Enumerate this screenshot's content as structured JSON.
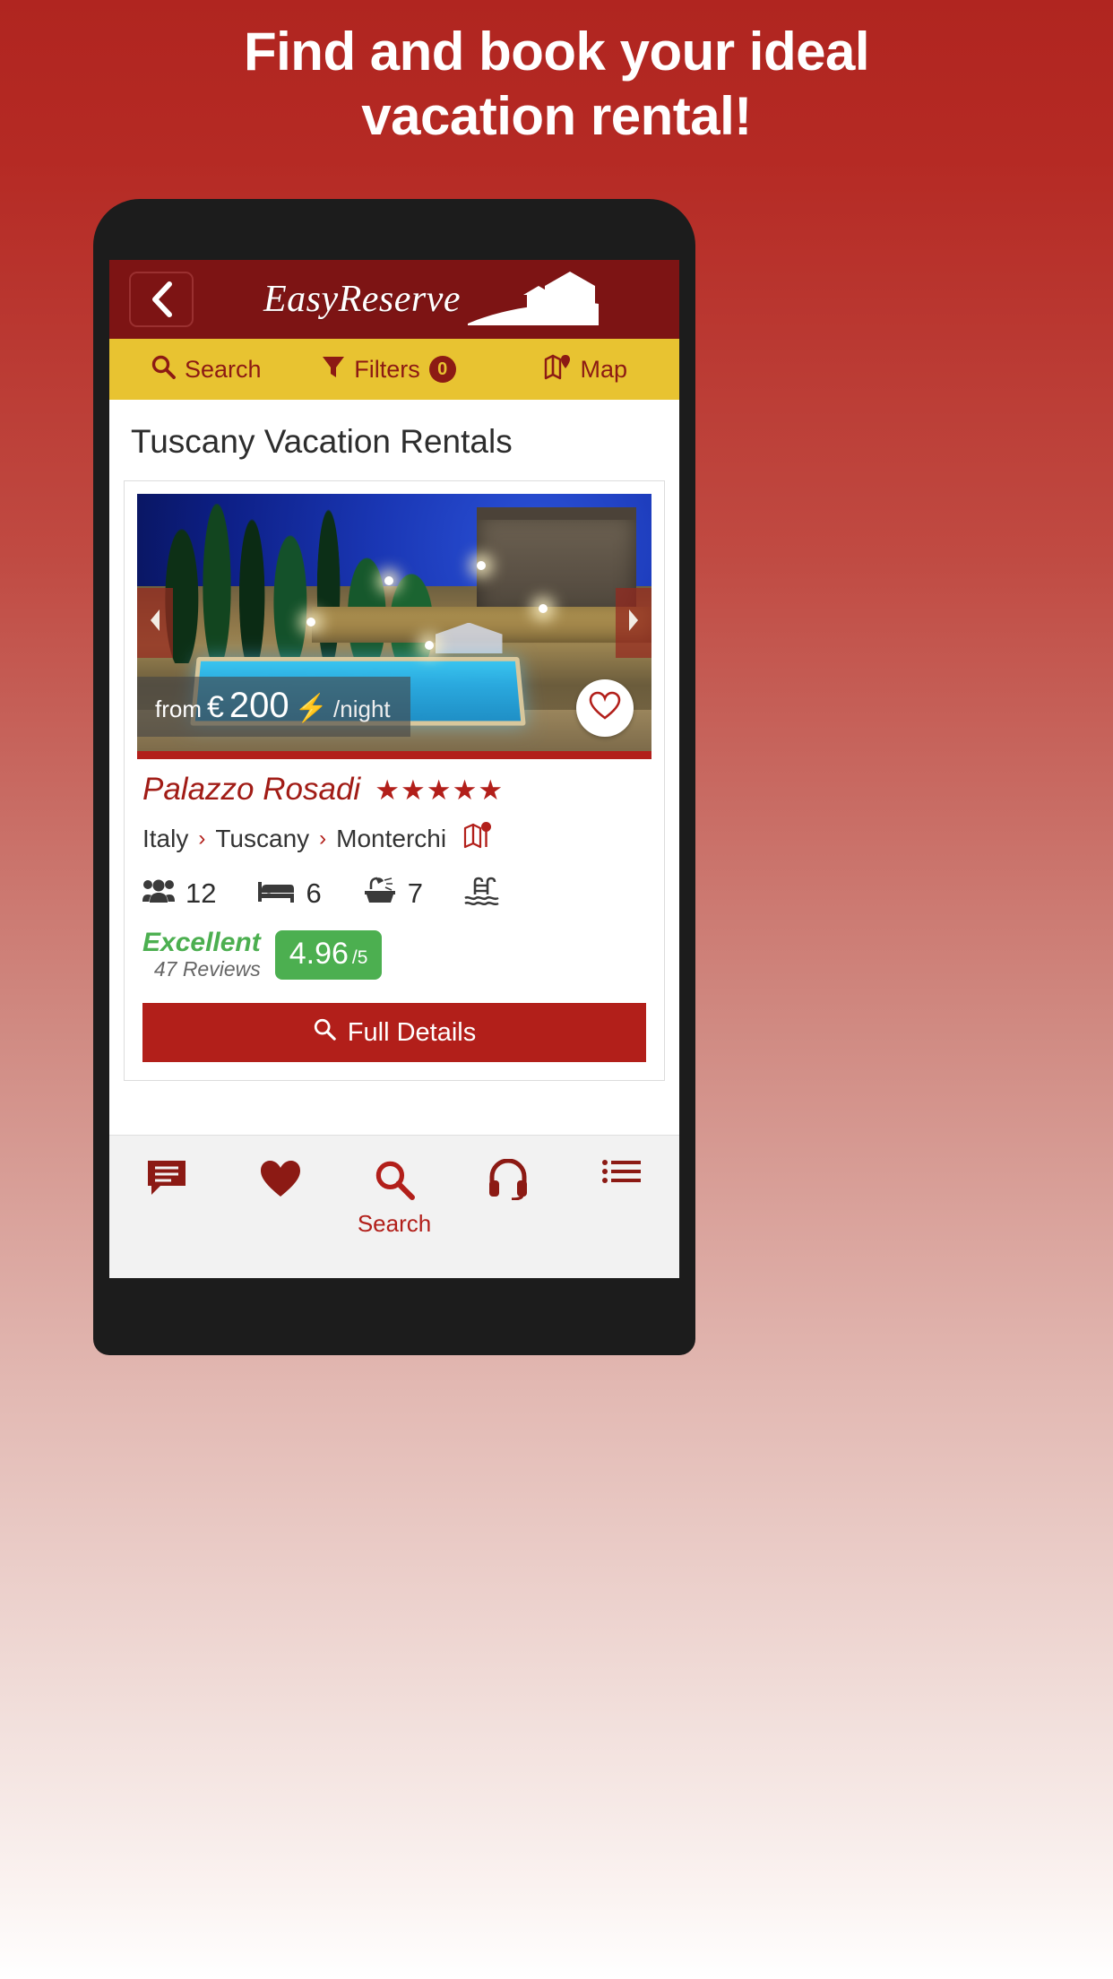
{
  "promo": {
    "line1": "Find and book your ideal",
    "line2": "vacation rental!"
  },
  "colors": {
    "brand_red": "#b21f1a",
    "header_red": "#7d1414",
    "toolbar_yellow": "#e8c331",
    "rating_green": "#4caf50",
    "bolt_yellow": "#f5c518"
  },
  "app": {
    "header": {
      "back_icon": "chevron-left-icon",
      "brand_name": "EasyReserve",
      "brand_mark_icon": "villa-landscape-icon"
    },
    "toolbar": {
      "search_label": "Search",
      "search_icon": "magnifier-icon",
      "filters_label": "Filters",
      "filters_icon": "funnel-icon",
      "filters_count": "0",
      "map_label": "Map",
      "map_icon": "map-icon"
    },
    "page_title": "Tuscany Vacation Rentals",
    "listing": {
      "photo_prev_icon": "chevron-left-icon",
      "photo_next_icon": "chevron-right-icon",
      "favorite_icon": "heart-outline-icon",
      "price": {
        "from": "from",
        "currency": "€",
        "amount": "200",
        "instant_icon": "lightning-bolt-icon",
        "per": "/night"
      },
      "name": "Palazzo Rosadi",
      "stars": "★★★★★",
      "star_count": 5,
      "breadcrumb": [
        "Italy",
        "Tuscany",
        "Monterchi"
      ],
      "breadcrumb_separator": "›",
      "breadcrumb_map_icon": "map-pin-icon",
      "amenities": [
        {
          "icon": "guests-icon",
          "value": "12"
        },
        {
          "icon": "bed-icon",
          "value": "6"
        },
        {
          "icon": "bathtub-icon",
          "value": "7"
        },
        {
          "icon": "pool-icon",
          "value": ""
        }
      ],
      "review": {
        "word": "Excellent",
        "count": "47 Reviews",
        "score": "4.96",
        "scale": "/5"
      },
      "details_button": {
        "label": "Full Details",
        "icon": "magnifier-icon"
      }
    },
    "bottom_nav": [
      {
        "icon": "chat-icon",
        "label": ""
      },
      {
        "icon": "heart-icon",
        "label": ""
      },
      {
        "icon": "magnifier-icon",
        "label": "Search"
      },
      {
        "icon": "headset-icon",
        "label": ""
      },
      {
        "icon": "list-icon",
        "label": ""
      }
    ]
  }
}
